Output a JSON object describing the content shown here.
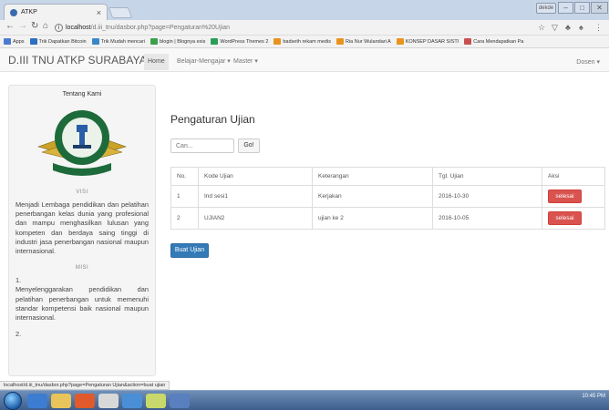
{
  "browser": {
    "tab_title": "ATKP",
    "tab_close": "×",
    "user_label": "dekde",
    "url_host": "localhost",
    "url_path": "/d.iii_tnu/dasbor.php?page=Pengaturan%20Ujian",
    "bookmarks": [
      {
        "label": "Apps",
        "color": "#4a7bd0"
      },
      {
        "label": "Trik Dapatkan Bitcoin",
        "color": "#2c6fbf"
      },
      {
        "label": "Trik Mudah mencari",
        "color": "#3b86c8"
      },
      {
        "label": "blogin | Blognya exis",
        "color": "#3aa14a"
      },
      {
        "label": "WordPress Themes 2",
        "color": "#2a9d55"
      },
      {
        "label": "badseth rekam medis",
        "color": "#e8931d"
      },
      {
        "label": "Ria Nur Wulandari A",
        "color": "#e8931d"
      },
      {
        "label": "KONSEP DASAR SISTI",
        "color": "#e8931d"
      },
      {
        "label": "Cara Mendapatkan Pa",
        "color": "#c94f4f"
      }
    ]
  },
  "nav": {
    "brand": "D.III TNU ATKP SURABAYA",
    "home": "Home",
    "belajar": "Belajar-Mengajar ▾",
    "master": "Master ▾",
    "dosen": "Dosen ▾"
  },
  "sidebar": {
    "title": "Tentang Kami",
    "logo_text": "SURABAYA",
    "logo_ring_text": "AKADEMI TEKNIK DAN KESELAMATAN",
    "visi_head": "VISI",
    "visi_text": "Menjadi Lembaga pendidikan dan pelatihan penerbangan kelas dunia yang profesional dan mampu menghasilkan lulusan yang kompeten dan berdaya saing tinggi di industri jasa penerbangan nasional maupun internasional.",
    "misi_head": "MISI",
    "misi_1_num": "1.",
    "misi_1_text": "Menyelenggarakan pendidikan dan pelatihan penerbangan untuk memenuhi standar kompetensi baik nasional maupun internasional.",
    "misi_2_num": "2."
  },
  "main": {
    "title": "Pengaturan Ujian",
    "search_placeholder": "Cari...",
    "go_label": "Go!",
    "columns": [
      "No.",
      "Kode Ujian",
      "Keterangan",
      "Tgl. Ujian",
      "Aksi"
    ],
    "rows": [
      {
        "no": "1",
        "kode": "Ind sesi1",
        "keterangan": "Kerjakan",
        "tgl": "2016-10-30",
        "aksi": "selesai"
      },
      {
        "no": "2",
        "kode": "UJIAN2",
        "keterangan": "ujian ke 2",
        "tgl": "2016-10-05",
        "aksi": "selesai"
      }
    ],
    "buat_label": "Buat Ujian"
  },
  "status_url": "localhost/d.iii_tnu/dasbor.php?page=Pengaturan Ujian&action=buat ujian",
  "taskbar": {
    "time": "10:45 PM"
  }
}
